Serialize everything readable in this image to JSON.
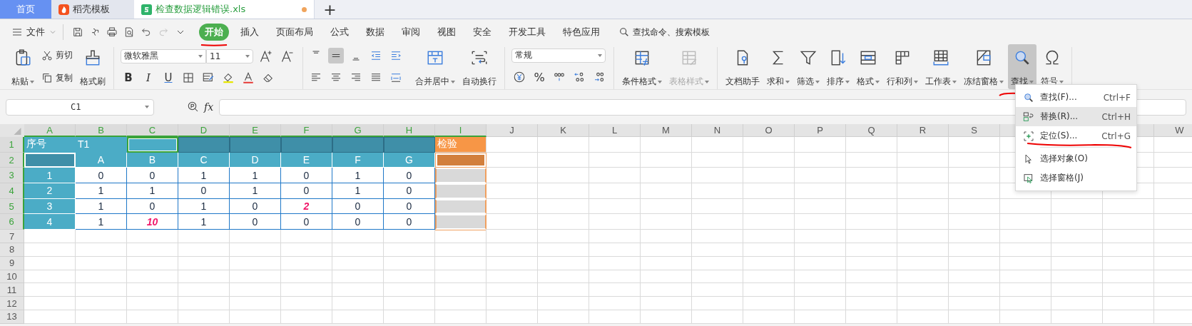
{
  "tab_bar": {
    "tabs": [
      {
        "label": "首页",
        "kind": "home",
        "selected": false
      },
      {
        "label": "稻壳模板",
        "kind": "docer",
        "selected": false
      },
      {
        "label": "检查数据逻辑错误.xls",
        "kind": "sheet",
        "selected": true,
        "unsaved": true
      }
    ],
    "new_tab": "+"
  },
  "menu_bar": {
    "file_menu": "文件",
    "ribbon_tabs": [
      {
        "label": "开始",
        "selected": true,
        "underlined": true
      },
      {
        "label": "插入",
        "selected": false,
        "underlined": false
      },
      {
        "label": "页面布局",
        "selected": false,
        "underlined": false
      },
      {
        "label": "公式",
        "selected": false,
        "underlined": false
      },
      {
        "label": "数据",
        "selected": false,
        "underlined": false
      },
      {
        "label": "审阅",
        "selected": false,
        "underlined": false
      },
      {
        "label": "视图",
        "selected": false,
        "underlined": false
      },
      {
        "label": "安全",
        "selected": false,
        "underlined": false
      },
      {
        "label": "开发工具",
        "selected": false,
        "underlined": false
      },
      {
        "label": "特色应用",
        "selected": false,
        "underlined": false
      }
    ],
    "search": {
      "placeholder": "查找命令、搜索模板"
    }
  },
  "ribbon": {
    "clipboard": {
      "paste": "粘贴",
      "cut": "剪切",
      "copy": "复制",
      "format_painter": "格式刷"
    },
    "font": {
      "family": "微软雅黑",
      "size": "11",
      "styles": [
        "B",
        "I",
        "U"
      ]
    },
    "alignment": {
      "vertical": [
        {
          "selected": false
        },
        {
          "selected": true
        },
        {
          "selected": false
        }
      ],
      "merge": "合并居中",
      "wrap": "自动换行"
    },
    "number": {
      "format": "常规",
      "percent": "%"
    },
    "styles": [
      {
        "label": "条件格式",
        "disabled": false
      },
      {
        "label": "表格样式",
        "disabled": true
      }
    ],
    "tools": [
      {
        "label": "文档助手",
        "dropdown": false,
        "selected": false,
        "underlined": false
      },
      {
        "label": "求和",
        "dropdown": true,
        "selected": false,
        "underlined": false
      },
      {
        "label": "筛选",
        "dropdown": true,
        "selected": false,
        "underlined": false
      },
      {
        "label": "排序",
        "dropdown": true,
        "selected": false,
        "underlined": false
      },
      {
        "label": "格式",
        "dropdown": true,
        "selected": false,
        "underlined": false
      },
      {
        "label": "行和列",
        "dropdown": true,
        "selected": false,
        "underlined": false
      },
      {
        "label": "工作表",
        "dropdown": true,
        "selected": false,
        "underlined": false
      },
      {
        "label": "冻结窗格",
        "dropdown": true,
        "selected": false,
        "underlined": false
      },
      {
        "label": "查找",
        "dropdown": true,
        "selected": true,
        "underlined": true
      },
      {
        "label": "符号",
        "dropdown": true,
        "selected": false,
        "underlined": false
      }
    ]
  },
  "formula_bar": {
    "name_box": "C1",
    "fx": "fx"
  },
  "sheet": {
    "columns": [
      {
        "label": "A",
        "selected": true
      },
      {
        "label": "B",
        "selected": true
      },
      {
        "label": "C",
        "selected": true
      },
      {
        "label": "D",
        "selected": true
      },
      {
        "label": "E",
        "selected": true
      },
      {
        "label": "F",
        "selected": true
      },
      {
        "label": "G",
        "selected": true
      },
      {
        "label": "H",
        "selected": true
      },
      {
        "label": "I",
        "selected": true
      },
      {
        "label": "J",
        "selected": false
      },
      {
        "label": "K",
        "selected": false
      },
      {
        "label": "L",
        "selected": false
      },
      {
        "label": "M",
        "selected": false
      },
      {
        "label": "N",
        "selected": false
      },
      {
        "label": "O",
        "selected": false
      },
      {
        "label": "P",
        "selected": false
      },
      {
        "label": "Q",
        "selected": false
      },
      {
        "label": "R",
        "selected": false
      },
      {
        "label": "S",
        "selected": false
      },
      {},
      {},
      {},
      {
        "label": "W",
        "selected": false
      }
    ],
    "rows": [
      {
        "label": "1",
        "selected": true,
        "cells": [
          {
            "text": "序号",
            "kind": "title"
          },
          {
            "text": "T1",
            "kind": "title"
          },
          {
            "kind": "active"
          },
          {
            "kind": "band"
          },
          {
            "kind": "band"
          },
          {
            "kind": "band"
          },
          {
            "kind": "band"
          },
          {
            "kind": "band"
          },
          {
            "text": "检验",
            "kind": "check-title"
          }
        ]
      },
      {
        "label": "2",
        "selected": true,
        "cells": [
          {
            "kind": "header-blank"
          },
          {
            "text": "A",
            "kind": "header"
          },
          {
            "text": "B",
            "kind": "header"
          },
          {
            "text": "C",
            "kind": "header"
          },
          {
            "text": "D",
            "kind": "header"
          },
          {
            "text": "E",
            "kind": "header"
          },
          {
            "text": "F",
            "kind": "header"
          },
          {
            "text": "G",
            "kind": "header"
          },
          {
            "kind": "check-head"
          }
        ]
      },
      {
        "label": "3",
        "selected": true,
        "cells": [
          {
            "text": "1",
            "kind": "index"
          },
          {
            "text": "0",
            "kind": "value",
            "flagged": false
          },
          {
            "text": "0",
            "kind": "value",
            "flagged": false
          },
          {
            "text": "1",
            "kind": "value",
            "flagged": false
          },
          {
            "text": "1",
            "kind": "value",
            "flagged": false
          },
          {
            "text": "0",
            "kind": "value",
            "flagged": false
          },
          {
            "text": "1",
            "kind": "value",
            "flagged": false
          },
          {
            "text": "0",
            "kind": "value",
            "flagged": false
          },
          {
            "kind": "check"
          }
        ]
      },
      {
        "label": "4",
        "selected": true,
        "cells": [
          {
            "text": "2",
            "kind": "index"
          },
          {
            "text": "1",
            "kind": "value",
            "flagged": false
          },
          {
            "text": "1",
            "kind": "value",
            "flagged": false
          },
          {
            "text": "0",
            "kind": "value",
            "flagged": false
          },
          {
            "text": "1",
            "kind": "value",
            "flagged": false
          },
          {
            "text": "0",
            "kind": "value",
            "flagged": false
          },
          {
            "text": "1",
            "kind": "value",
            "flagged": false
          },
          {
            "text": "0",
            "kind": "value",
            "flagged": false
          },
          {
            "kind": "check"
          }
        ]
      },
      {
        "label": "5",
        "selected": true,
        "cells": [
          {
            "text": "3",
            "kind": "index"
          },
          {
            "text": "1",
            "kind": "value",
            "flagged": false
          },
          {
            "text": "0",
            "kind": "value",
            "flagged": false
          },
          {
            "text": "1",
            "kind": "value",
            "flagged": false
          },
          {
            "text": "0",
            "kind": "value",
            "flagged": false
          },
          {
            "text": "2",
            "kind": "value",
            "flagged": true
          },
          {
            "text": "0",
            "kind": "value",
            "flagged": false
          },
          {
            "text": "0",
            "kind": "value",
            "flagged": false
          },
          {
            "kind": "check"
          }
        ]
      },
      {
        "label": "6",
        "selected": true,
        "cells": [
          {
            "text": "4",
            "kind": "index"
          },
          {
            "text": "1",
            "kind": "value",
            "flagged": false
          },
          {
            "text": "10",
            "kind": "value",
            "flagged": true
          },
          {
            "text": "1",
            "kind": "value",
            "flagged": false
          },
          {
            "text": "0",
            "kind": "value",
            "flagged": false
          },
          {
            "text": "0",
            "kind": "value",
            "flagged": false
          },
          {
            "text": "0",
            "kind": "value",
            "flagged": false
          },
          {
            "text": "0",
            "kind": "value",
            "flagged": false
          },
          {
            "kind": "check"
          }
        ]
      },
      {
        "label": "7",
        "selected": false,
        "cells": []
      },
      {
        "label": "8",
        "selected": false,
        "cells": []
      },
      {
        "label": "9",
        "selected": false,
        "cells": []
      },
      {
        "label": "10",
        "selected": false,
        "cells": []
      },
      {
        "label": "11",
        "selected": false,
        "cells": []
      },
      {
        "label": "12",
        "selected": false,
        "cells": []
      },
      {
        "label": "13",
        "selected": false,
        "cells": []
      }
    ]
  },
  "find_menu": {
    "items": [
      {
        "label": "查找(F)...",
        "shortcut": "Ctrl+F",
        "selected": false,
        "underlined": false,
        "separator_before": false
      },
      {
        "label": "替换(R)...",
        "shortcut": "Ctrl+H",
        "selected": true,
        "underlined": false,
        "separator_before": false
      },
      {
        "label": "定位(S)...",
        "shortcut": "Ctrl+G",
        "selected": false,
        "underlined": true,
        "separator_before": false
      },
      {
        "label": "选择对象(O)",
        "selected": false,
        "underlined": false,
        "separator_before": true
      },
      {
        "label": "选择窗格(J)",
        "selected": false,
        "underlined": false,
        "separator_before": false
      }
    ]
  }
}
